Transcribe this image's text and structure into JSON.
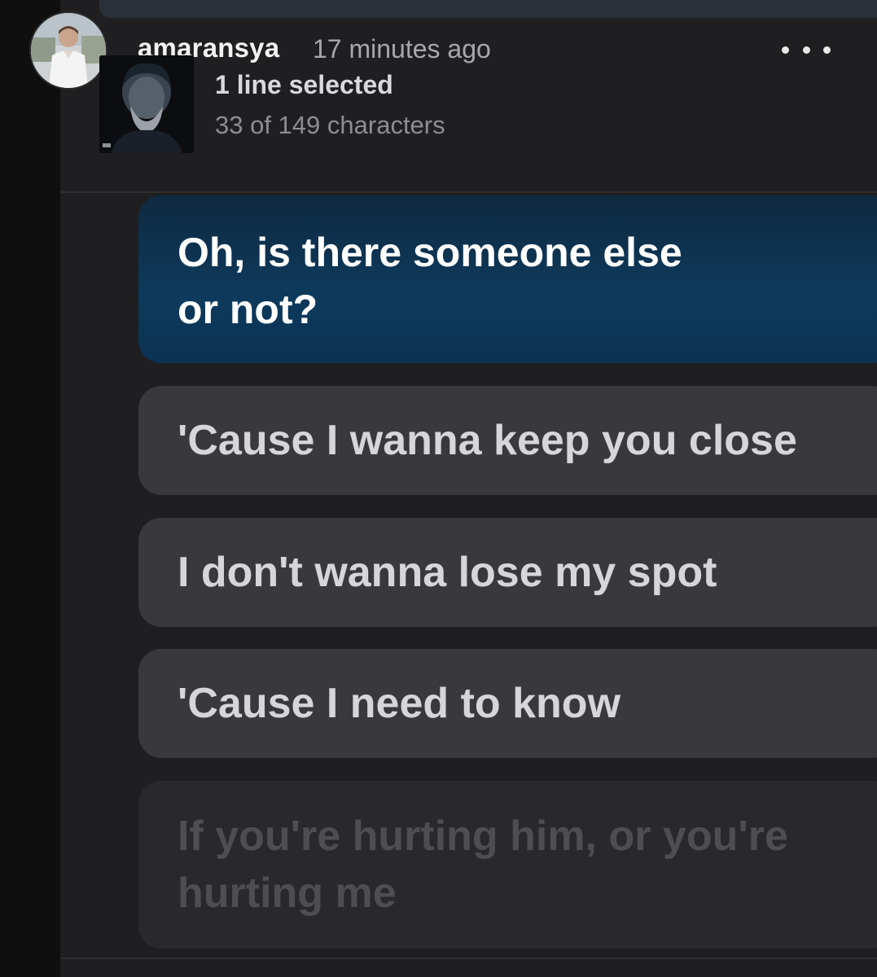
{
  "post": {
    "username": "amaransya",
    "timestamp": "17 minutes ago",
    "more_icon": "ellipsis-icon"
  },
  "selection": {
    "title": "1 line selected",
    "count": "33 of 149 characters"
  },
  "lyrics": [
    {
      "text": "Oh, is there someone else\nor not?",
      "state": "selected"
    },
    {
      "text": "'Cause I wanna keep you close",
      "state": "normal"
    },
    {
      "text": "I don't wanna lose my spot",
      "state": "normal"
    },
    {
      "text": "'Cause I need to know",
      "state": "normal"
    },
    {
      "text": "If you're hurting him, or you're\nhurting me",
      "state": "disabled"
    }
  ],
  "colors": {
    "selected_card": "#0d3a5c",
    "normal_card": "#39393c",
    "disabled_text": "#4e4e51",
    "panel": "#1f1f21"
  }
}
